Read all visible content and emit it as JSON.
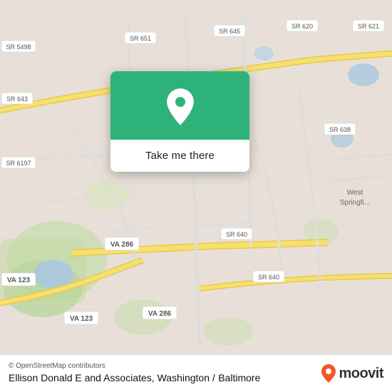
{
  "map": {
    "background_color": "#e8e0d8"
  },
  "popup": {
    "button_label": "Take me there",
    "pin_icon": "location-pin"
  },
  "bottom_bar": {
    "osm_credit": "© OpenStreetMap contributors",
    "place_name": "Ellison Donald E and Associates, Washington /",
    "place_name2": "Baltimore",
    "moovit_label": "moovit"
  },
  "road_labels": [
    "SR 620",
    "SR 621",
    "SR 651",
    "SR 645",
    "SR 5498",
    "SR 643",
    "SR 638",
    "SR 6197",
    "VA 286",
    "VA 123",
    "SR 640",
    "West Springfield"
  ],
  "colors": {
    "map_bg": "#e8e0d8",
    "road_main": "#f5e6a0",
    "road_minor": "#ffffff",
    "green_area": "#c8ddb0",
    "water": "#b0d4e8",
    "popup_green": "#2db37a",
    "moovit_orange": "#f05a28"
  }
}
